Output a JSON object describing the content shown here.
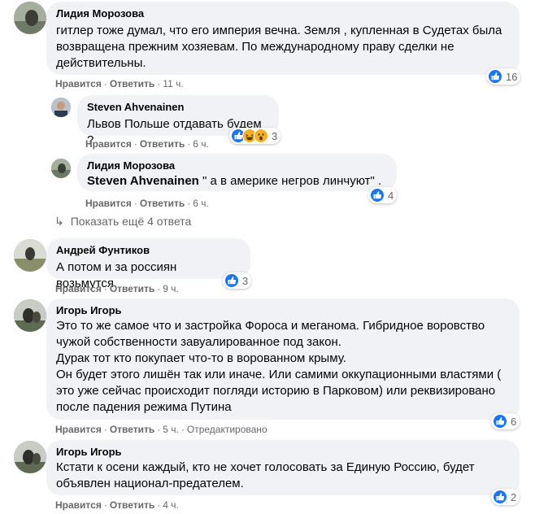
{
  "colors": {
    "bubble": "#f0f2f5",
    "like_blue": "#1877f2",
    "secondary_text": "#65676b",
    "love_red": "#f33e58",
    "haha_yellow": "#f7b125"
  },
  "comments": [
    {
      "author": "Лидия Морозова",
      "text": "гитлер тоже думал, что его империя вечна. Земля , купленная в Судетах была возвращена прежним хозяевам. По международному праву сделки не действительны.",
      "like": "Нравится",
      "reply": "Ответить",
      "time": "11 ч.",
      "reactions": [
        "like-icon"
      ],
      "reaction_count": "16",
      "replies": [
        {
          "author": "Steven Ahvenainen",
          "text": "Львов Польше отдавать будем ?",
          "like": "Нравится",
          "reply": "Ответить",
          "time": "6 ч.",
          "reactions": [
            "like-icon",
            "haha-icon",
            "wow-icon"
          ],
          "reaction_count": "3"
        },
        {
          "author": "Лидия Морозова",
          "mention": "Steven Ahvenainen",
          "text": " \" а в америке негров линчуют\" .",
          "like": "Нравится",
          "reply": "Ответить",
          "time": "6 ч.",
          "reactions": [
            "like-icon"
          ],
          "reaction_count": "4"
        }
      ],
      "more_replies": "Показать ещё 4 ответа"
    },
    {
      "author": "Андрей Фунтиков",
      "text": "А потом и за россиян возьмутся.",
      "like": "Нравится",
      "reply": "Ответить",
      "time": "9 ч.",
      "reactions": [
        "like-icon"
      ],
      "reaction_count": "3"
    },
    {
      "author": "Игорь Игорь",
      "text": "Это то же самое что и застройка Фороса и меганома. Гибридное воровство чужой собственности завуалированное под закон.\nДурак тот кто покупает что-то в ворованном крыму.\nОн будет этого лишён так или иначе. Или самими оккупационными властями ( это уже сейчас происходит погляди историю в Парковом) или реквизировано после падения режима Путина",
      "like": "Нравится",
      "reply": "Ответить",
      "time": "5 ч.",
      "edited": "Отредактировано",
      "reactions": [
        "like-icon"
      ],
      "reaction_count": "6"
    },
    {
      "author": "Игорь Игорь",
      "text": "Кстати к осени каждый, кто не хочет голосовать за Единую Россию, будет объявлен национал-предателем.",
      "like": "Нравится",
      "reply": "Ответить",
      "time": "4 ч.",
      "reactions": [
        "like-icon"
      ],
      "reaction_count": "2"
    }
  ]
}
